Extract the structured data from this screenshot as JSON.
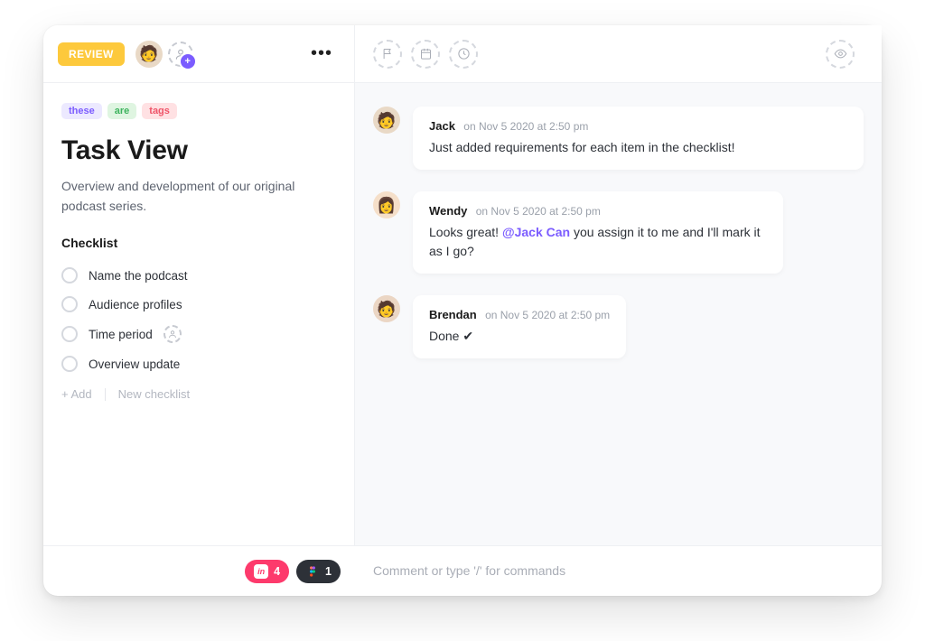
{
  "left": {
    "status": "REVIEW",
    "tags": [
      "these",
      "are",
      "tags"
    ],
    "title": "Task View",
    "description": "Overview and development of our original podcast series.",
    "checklist_label": "Checklist",
    "items": [
      {
        "label": "Name the podcast",
        "has_assignee_placeholder": false
      },
      {
        "label": "Audience profiles",
        "has_assignee_placeholder": false
      },
      {
        "label": "Time period",
        "has_assignee_placeholder": true
      },
      {
        "label": "Overview update",
        "has_assignee_placeholder": false
      }
    ],
    "add_label": "+ Add",
    "new_checklist_label": "New checklist"
  },
  "comments": [
    {
      "author": "Jack",
      "meta": "on Nov 5 2020 at 2:50 pm",
      "body": "Just added requirements for each item in the checklist!",
      "wide": true,
      "avatar_bg": "bg1"
    },
    {
      "author": "Wendy",
      "meta": "on Nov 5 2020 at 2:50 pm",
      "body_pre": "Looks great! ",
      "mention": "@Jack Can",
      "body_post": " you assign it to me and I'll mark it as I go?",
      "wide": false,
      "avatar_bg": "bg2"
    },
    {
      "author": "Brendan",
      "meta": "on Nov 5 2020 at 2:50 pm",
      "body": "Done ✔",
      "wide": false,
      "avatar_bg": "bg3"
    }
  ],
  "footer": {
    "chip_pink_count": "4",
    "chip_dark_count": "1",
    "comment_placeholder": "Comment or type '/' for commands"
  },
  "icons": {
    "person": "person-icon",
    "flag": "flag-icon",
    "calendar": "calendar-icon",
    "clock": "clock-icon",
    "eye": "eye-icon"
  }
}
